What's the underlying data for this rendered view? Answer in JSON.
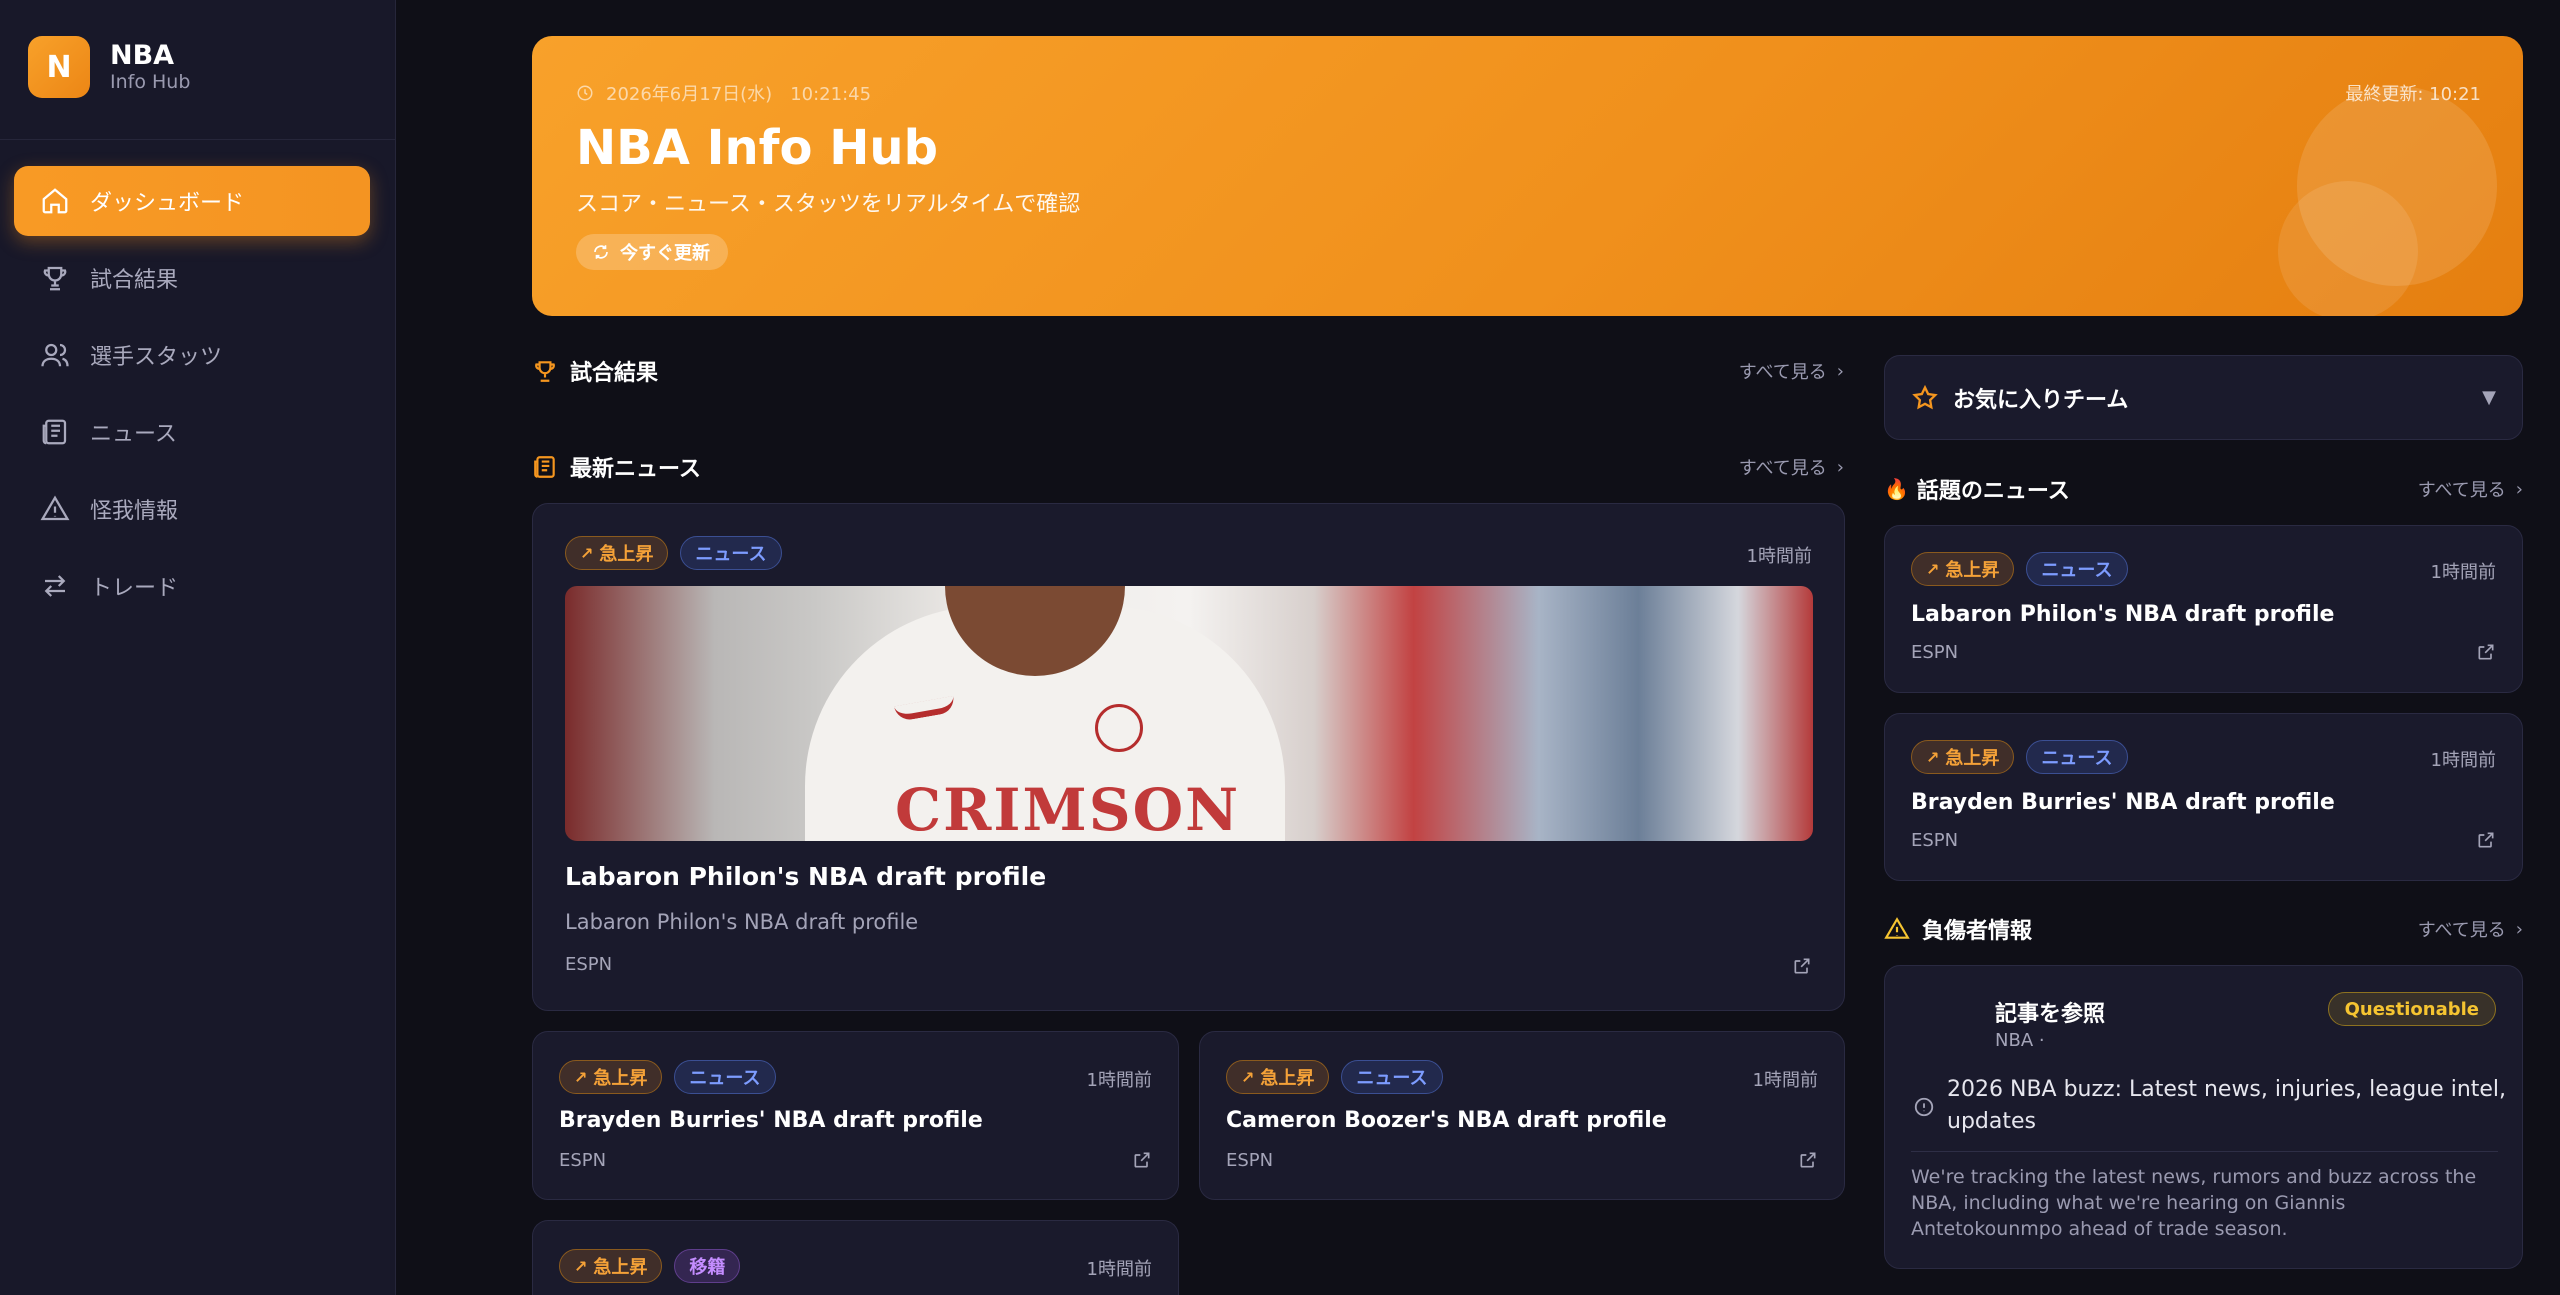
{
  "sidebar": {
    "brand": {
      "logo_letter": "N",
      "name": "NBA",
      "sub": "Info Hub"
    },
    "items": [
      {
        "label": "ダッシュボード",
        "icon": "home-icon",
        "active": true
      },
      {
        "label": "試合結果",
        "icon": "trophy-icon"
      },
      {
        "label": "選手スタッツ",
        "icon": "users-icon"
      },
      {
        "label": "ニュース",
        "icon": "newspaper-icon"
      },
      {
        "label": "怪我情報",
        "icon": "warning-icon"
      },
      {
        "label": "トレード",
        "icon": "swap-icon"
      }
    ]
  },
  "hero": {
    "datetime": "2026年6月17日(水)　10:21:45",
    "updated": "最終更新: 10:21",
    "title": "NBA Info Hub",
    "subtitle": "スコア・ニュース・スタッツをリアルタイムで確認",
    "refresh_label": "今すぐ更新"
  },
  "sections": {
    "games_title": "試合結果",
    "news_title": "最新ニュース",
    "see_all": "すべて見る",
    "favorites_title": "お気に入りチーム",
    "trending_title": "話題のニュース",
    "injury_title": "負傷者情報"
  },
  "featured": {
    "tags": [
      "急上昇",
      "ニュース"
    ],
    "time": "1時間前",
    "title": "Labaron Philon's NBA draft profile",
    "description": "Labaron Philon's NBA draft profile",
    "source": "ESPN",
    "photo_text": "CRIMSON"
  },
  "news_grid": [
    {
      "tags": [
        "急上昇",
        "ニュース"
      ],
      "time": "1時間前",
      "title": "Brayden Burries' NBA draft profile",
      "source": "ESPN"
    },
    {
      "tags": [
        "急上昇",
        "ニュース"
      ],
      "time": "1時間前",
      "title": "Cameron Boozer's NBA draft profile",
      "source": "ESPN"
    },
    {
      "tags": [
        "急上昇",
        "移籍"
      ],
      "time": "1時間前"
    }
  ],
  "trending": [
    {
      "tags": [
        "急上昇",
        "ニュース"
      ],
      "time": "1時間前",
      "title": "Labaron Philon's NBA draft profile",
      "source": "ESPN"
    },
    {
      "tags": [
        "急上昇",
        "ニュース"
      ],
      "time": "1時間前",
      "title": "Brayden Burries' NBA draft profile",
      "source": "ESPN"
    }
  ],
  "injury": {
    "name": "記事を参照",
    "team": "NBA ·",
    "status": "Questionable",
    "headline": "2026 NBA buzz: Latest news, injuries, league intel, updates",
    "body": "We're tracking the latest news, rumors and buzz across the NBA, including what we're hearing on Giannis Antetokounmpo ahead of trade season."
  },
  "colors": {
    "accent": "#f5961f",
    "background": "#0f0f17",
    "card": "#1a1a2c",
    "questionable": "#f5c431"
  }
}
